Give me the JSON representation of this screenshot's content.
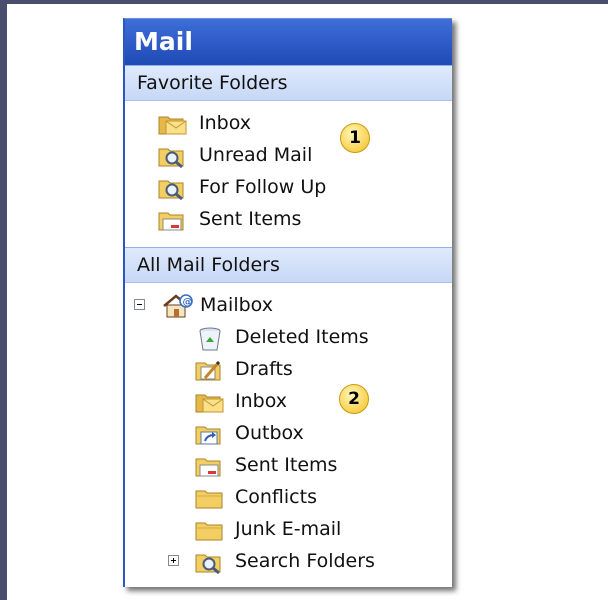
{
  "pane": {
    "title": "Mail",
    "favorites": {
      "header": "Favorite Folders",
      "items": [
        {
          "label": "Inbox",
          "icon": "inbox-folder-icon"
        },
        {
          "label": "Unread Mail",
          "icon": "search-folder-icon"
        },
        {
          "label": "For Follow Up",
          "icon": "search-folder-icon"
        },
        {
          "label": "Sent Items",
          "icon": "sent-items-folder-icon"
        }
      ]
    },
    "all_folders": {
      "header": "All Mail Folders",
      "root": {
        "label": "Mailbox",
        "icon": "mailbox-icon",
        "expanded": true
      },
      "children": [
        {
          "label": "Deleted Items",
          "icon": "recycle-bin-icon"
        },
        {
          "label": "Drafts",
          "icon": "drafts-folder-icon"
        },
        {
          "label": "Inbox",
          "icon": "inbox-folder-icon"
        },
        {
          "label": "Outbox",
          "icon": "outbox-folder-icon"
        },
        {
          "label": "Sent Items",
          "icon": "sent-items-folder-icon"
        },
        {
          "label": "Conflicts",
          "icon": "folder-icon"
        },
        {
          "label": "Junk E-mail",
          "icon": "folder-icon"
        },
        {
          "label": "Search Folders",
          "icon": "search-folder-icon",
          "expanded": false
        }
      ]
    }
  },
  "callouts": [
    "1",
    "2"
  ],
  "colors": {
    "title_bar": "#2b56bd",
    "section_header": "#c6d8f6",
    "badge": "#f4c020",
    "folder": "#f3cf63"
  }
}
